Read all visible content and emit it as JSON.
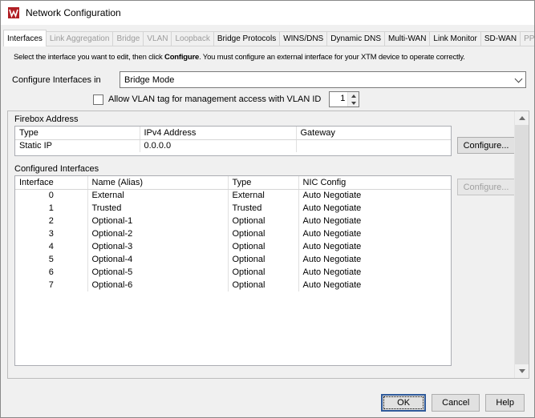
{
  "window": {
    "title": "Network Configuration"
  },
  "tabs": [
    {
      "label": "Interfaces",
      "state": "active",
      "interactable": true
    },
    {
      "label": "Link Aggregation",
      "state": "disabled",
      "interactable": false
    },
    {
      "label": "Bridge",
      "state": "disabled",
      "interactable": false
    },
    {
      "label": "VLAN",
      "state": "disabled",
      "interactable": false
    },
    {
      "label": "Loopback",
      "state": "disabled",
      "interactable": false
    },
    {
      "label": "Bridge Protocols",
      "state": "normal",
      "interactable": true
    },
    {
      "label": "WINS/DNS",
      "state": "normal",
      "interactable": true
    },
    {
      "label": "Dynamic DNS",
      "state": "normal",
      "interactable": true
    },
    {
      "label": "Multi-WAN",
      "state": "normal",
      "interactable": true
    },
    {
      "label": "Link Monitor",
      "state": "normal",
      "interactable": true
    },
    {
      "label": "SD-WAN",
      "state": "normal",
      "interactable": true
    },
    {
      "label": "PPPoE",
      "state": "disabled",
      "interactable": false
    }
  ],
  "instructions": {
    "before": "Select the interface you want to edit, then click ",
    "bold": "Configure",
    "after": ". You must configure an external interface for your XTM device to operate correctly."
  },
  "configure_mode": {
    "label": "Configure Interfaces in",
    "value": "Bridge Mode"
  },
  "vlan": {
    "checkbox_label": "Allow VLAN tag for management access with VLAN ID",
    "checked": false,
    "vlan_id": "1"
  },
  "firebox_address": {
    "section_title": "Firebox Address",
    "columns": [
      "Type",
      "IPv4 Address",
      "Gateway"
    ],
    "rows": [
      {
        "type": "Static IP",
        "ipv4": "0.0.0.0",
        "gateway": ""
      }
    ],
    "configure_button": "Configure..."
  },
  "configured_interfaces": {
    "section_title": "Configured Interfaces",
    "columns": [
      "Interface",
      "Name (Alias)",
      "Type",
      "NIC Config"
    ],
    "rows": [
      {
        "iface": "0",
        "name": "External",
        "type": "External",
        "nic": "Auto Negotiate"
      },
      {
        "iface": "1",
        "name": "Trusted",
        "type": "Trusted",
        "nic": "Auto Negotiate"
      },
      {
        "iface": "2",
        "name": "Optional-1",
        "type": "Optional",
        "nic": "Auto Negotiate"
      },
      {
        "iface": "3",
        "name": "Optional-2",
        "type": "Optional",
        "nic": "Auto Negotiate"
      },
      {
        "iface": "4",
        "name": "Optional-3",
        "type": "Optional",
        "nic": "Auto Negotiate"
      },
      {
        "iface": "5",
        "name": "Optional-4",
        "type": "Optional",
        "nic": "Auto Negotiate"
      },
      {
        "iface": "6",
        "name": "Optional-5",
        "type": "Optional",
        "nic": "Auto Negotiate"
      },
      {
        "iface": "7",
        "name": "Optional-6",
        "type": "Optional",
        "nic": "Auto Negotiate"
      }
    ],
    "configure_button": "Configure...",
    "configure_enabled": false
  },
  "footer": {
    "ok": "OK",
    "cancel": "Cancel",
    "help": "Help"
  },
  "colors": {
    "app_icon_red": "#b01f24",
    "default_button_border": "#2f5a9a",
    "disabled_text": "#9c9c9c"
  }
}
